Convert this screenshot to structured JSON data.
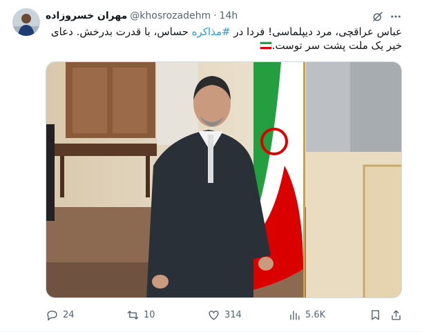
{
  "tweet": {
    "display_name": "مهران خسروزاده",
    "handle": "@khosrozadehm",
    "separator": "·",
    "time": "14h",
    "text_part1": "عباس عراقچی، مرد دیپلماسی! فردا در ",
    "hashtag": "#مذاکره",
    "text_part2": " حساس، با قدرت بدرخش. دعای خیر یک ملت پشت سر توست.",
    "flag_emoji": "iran-flag",
    "media_alt": "photo"
  },
  "actions": {
    "replies": "24",
    "reposts": "10",
    "likes": "314",
    "views": "5.6K"
  },
  "colors": {
    "text": "#0f1419",
    "secondary": "#536471",
    "link": "#1d9bf0",
    "border": "#cfd9de"
  },
  "icons": [
    "grok-icon",
    "more-icon",
    "reply-icon",
    "repost-icon",
    "like-icon",
    "views-icon",
    "bookmark-icon",
    "share-icon"
  ]
}
